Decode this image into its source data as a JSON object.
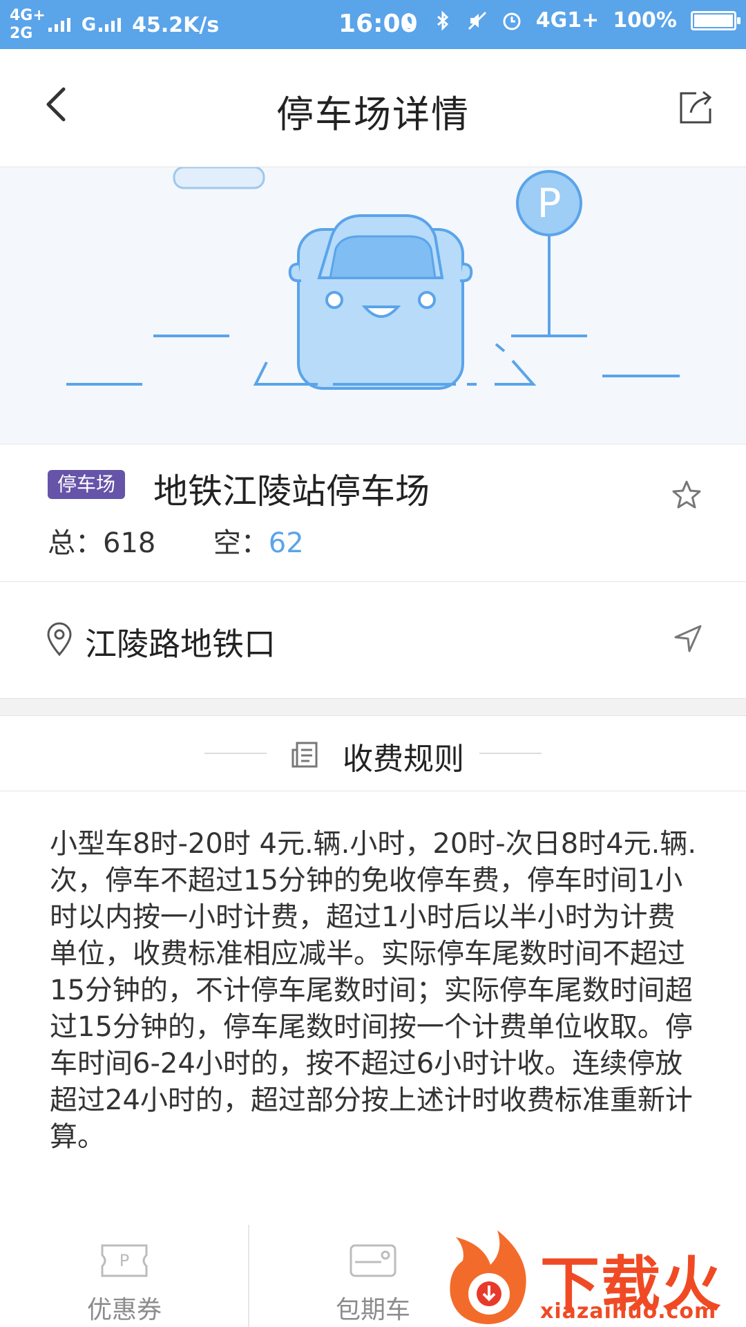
{
  "status_bar": {
    "net1": "4G+",
    "net2": "2G",
    "net3": "G",
    "speed": "45.2K/s",
    "time": "16:00",
    "net4": "4G1+",
    "battery_text": "100%",
    "battery_level": 1.0
  },
  "nav": {
    "title": "停车场详情",
    "back_icon": "chevron-left-icon",
    "share_icon": "share-icon"
  },
  "lot": {
    "tag": "停车场",
    "name": "地铁江陵站停车场",
    "total_label": "总：",
    "total_value": "618",
    "free_label": "空：",
    "free_value": "62",
    "free_color": "#5aa4ea",
    "tag_color": "#6554a8"
  },
  "address": {
    "text": "江陵路地铁口"
  },
  "rules": {
    "title": "收费规则",
    "body": "小型车8时-20时 4元.辆.小时，20时-次日8时4元.辆.次，停车不超过15分钟的免收停车费，停车时间1小时以内按一小时计费，超过1小时后以半小时为计费单位，收费标准相应减半。实际停车尾数时间不超过15分钟的，不计停车尾数时间；实际停车尾数时间超过15分钟的，停车尾数时间按一个计费单位收取。停车时间6-24小时的，按不超过6小时计收。连续停放超过24小时的，超过部分按上述计时收费标准重新计算。"
  },
  "bottom_tabs": [
    {
      "label": "优惠券",
      "icon": "coupon-icon"
    },
    {
      "label": "包期车",
      "icon": "card-icon"
    }
  ],
  "watermark": {
    "text": "下载火",
    "url": "xiazaihuo.com"
  }
}
